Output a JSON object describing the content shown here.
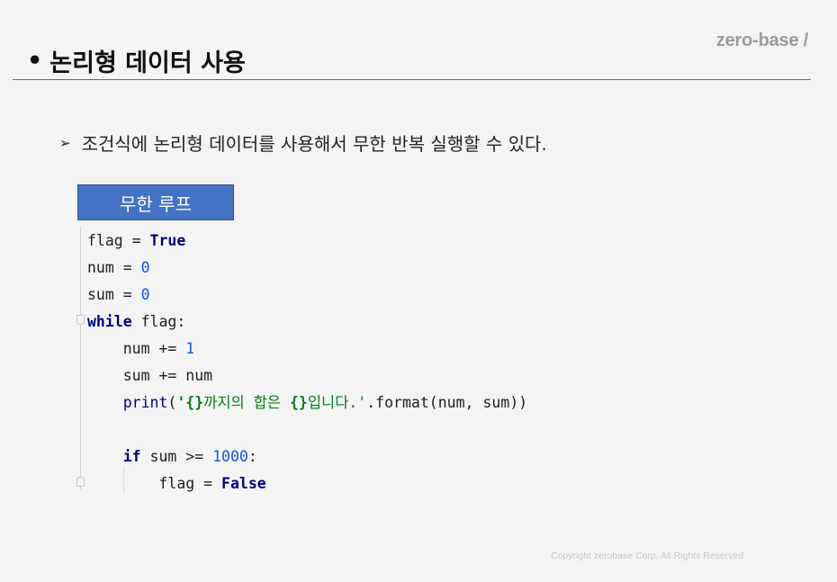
{
  "logo": "zero-base /",
  "title": {
    "bullet": "•",
    "text": "논리형 데이터 사용"
  },
  "point": {
    "arrow": "➢",
    "text": "조건식에 논리형 데이터를 사용해서 무한 반복 실행할 수 있다."
  },
  "code_label": "무한 루프",
  "code": {
    "l1": {
      "a": "flag = ",
      "b": "True"
    },
    "l2": {
      "a": "num = ",
      "b": "0"
    },
    "l3": {
      "a": "sum = ",
      "b": "0"
    },
    "l4": {
      "a": "while",
      "b": " flag:"
    },
    "l5": {
      "a": "    num += ",
      "b": "1"
    },
    "l6": {
      "a": "    sum += num"
    },
    "l7": {
      "a": "    ",
      "b": "print",
      "c": "(",
      "d": "'{}",
      "e": "까지의 합은 ",
      "f": "{}",
      "g": "입니다.'",
      "h": ".format(num, sum))"
    },
    "l9": {
      "a": "    ",
      "b": "if",
      "c": " sum >= ",
      "d": "1000",
      "e": ":"
    },
    "l10": {
      "a": "        flag = ",
      "b": "False"
    }
  },
  "footer": "Copyright zerobase Corp. All Rights Reserved"
}
